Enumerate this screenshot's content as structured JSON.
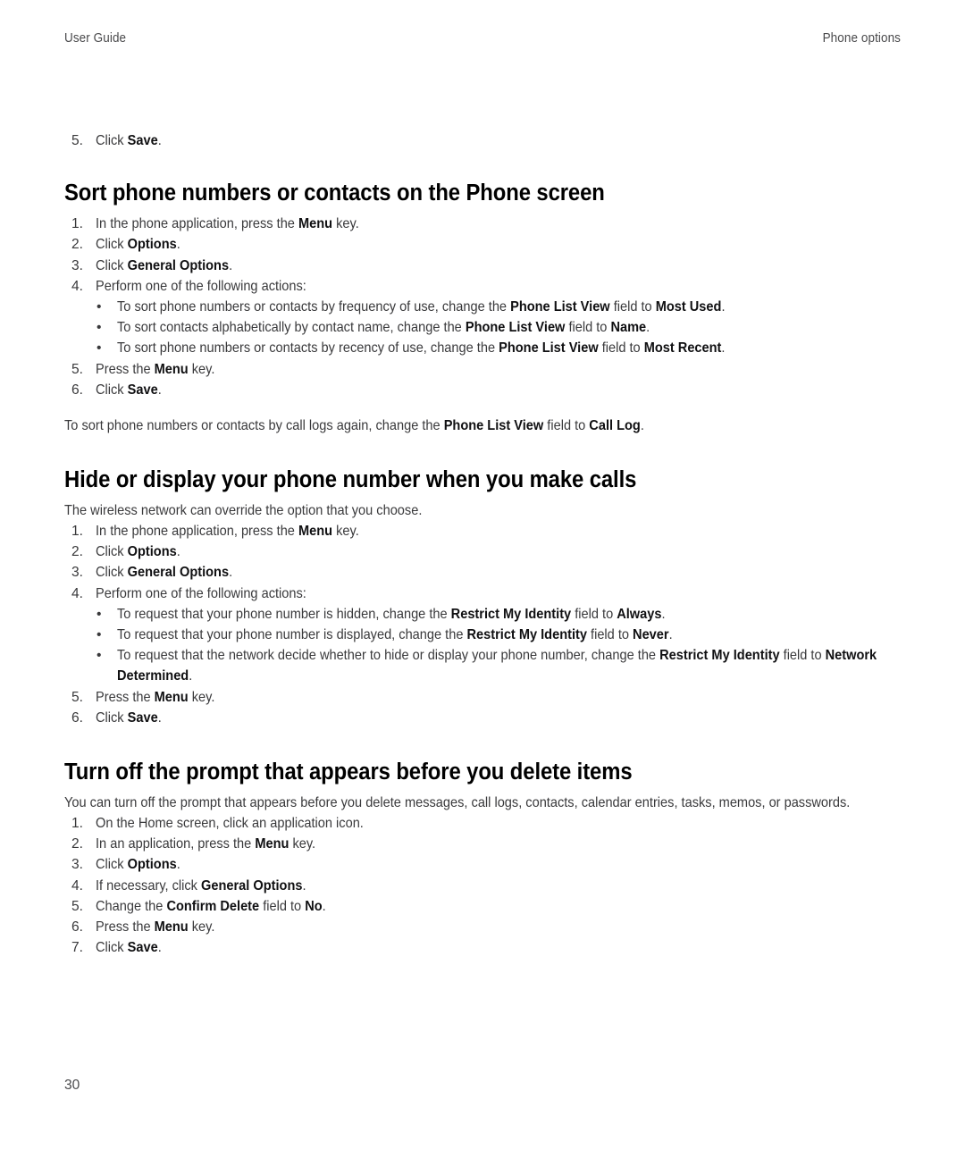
{
  "header": {
    "left": "User Guide",
    "right": "Phone options"
  },
  "folio": {
    "page_number": "30"
  },
  "intro_step": {
    "number": "5.",
    "text_before": "Click ",
    "bold": "Save",
    "text_after": "."
  },
  "sections": [
    {
      "id": "sort-phone-numbers",
      "title": "Sort phone numbers or contacts on the Phone screen",
      "intro": "",
      "steps": [
        {
          "number": "1.",
          "parts": [
            {
              "t": "In the phone application, press the ",
              "b": false
            },
            {
              "t": "Menu",
              "b": true
            },
            {
              "t": " key.",
              "b": false
            }
          ]
        },
        {
          "number": "2.",
          "parts": [
            {
              "t": "Click ",
              "b": false
            },
            {
              "t": "Options",
              "b": true
            },
            {
              "t": ".",
              "b": false
            }
          ]
        },
        {
          "number": "3.",
          "parts": [
            {
              "t": "Click ",
              "b": false
            },
            {
              "t": "General Options",
              "b": true
            },
            {
              "t": ".",
              "b": false
            }
          ]
        },
        {
          "number": "4.",
          "parts": [
            {
              "t": "Perform one of the following actions:",
              "b": false
            }
          ]
        }
      ],
      "bullets": [
        {
          "bullet": "•",
          "parts": [
            {
              "t": "To sort phone numbers or contacts by frequency of use, change the ",
              "b": false
            },
            {
              "t": "Phone List View",
              "b": true
            },
            {
              "t": " field to ",
              "b": false
            },
            {
              "t": "Most Used",
              "b": true
            },
            {
              "t": ".",
              "b": false
            }
          ]
        },
        {
          "bullet": "•",
          "parts": [
            {
              "t": "To sort contacts alphabetically by contact name, change the ",
              "b": false
            },
            {
              "t": "Phone List View",
              "b": true
            },
            {
              "t": " field to ",
              "b": false
            },
            {
              "t": "Name",
              "b": true
            },
            {
              "t": ".",
              "b": false
            }
          ]
        },
        {
          "bullet": "•",
          "parts": [
            {
              "t": "To sort phone numbers or contacts by recency of use, change the ",
              "b": false
            },
            {
              "t": "Phone List View",
              "b": true
            },
            {
              "t": " field to ",
              "b": false
            },
            {
              "t": "Most Recent",
              "b": true
            },
            {
              "t": ".",
              "b": false
            }
          ]
        }
      ],
      "steps_after": [
        {
          "number": "5.",
          "parts": [
            {
              "t": "Press the ",
              "b": false
            },
            {
              "t": "Menu",
              "b": true
            },
            {
              "t": " key.",
              "b": false
            }
          ]
        },
        {
          "number": "6.",
          "parts": [
            {
              "t": "Click ",
              "b": false
            },
            {
              "t": "Save",
              "b": true
            },
            {
              "t": ".",
              "b": false
            }
          ]
        }
      ],
      "outro": [
        {
          "t": "To sort phone numbers or contacts by call logs again, change the ",
          "b": false
        },
        {
          "t": "Phone List View",
          "b": true
        },
        {
          "t": " field to ",
          "b": false
        },
        {
          "t": "Call Log",
          "b": true
        },
        {
          "t": ".",
          "b": false
        }
      ]
    },
    {
      "id": "hide-or-display-number",
      "title": "Hide or display your phone number when you make calls",
      "intro": "The wireless network can override the option that you choose.",
      "steps": [
        {
          "number": "1.",
          "parts": [
            {
              "t": "In the phone application, press the ",
              "b": false
            },
            {
              "t": "Menu",
              "b": true
            },
            {
              "t": " key.",
              "b": false
            }
          ]
        },
        {
          "number": "2.",
          "parts": [
            {
              "t": "Click ",
              "b": false
            },
            {
              "t": "Options",
              "b": true
            },
            {
              "t": ".",
              "b": false
            }
          ]
        },
        {
          "number": "3.",
          "parts": [
            {
              "t": "Click ",
              "b": false
            },
            {
              "t": "General Options",
              "b": true
            },
            {
              "t": ".",
              "b": false
            }
          ]
        },
        {
          "number": "4.",
          "parts": [
            {
              "t": "Perform one of the following actions:",
              "b": false
            }
          ]
        }
      ],
      "bullets": [
        {
          "bullet": "•",
          "parts": [
            {
              "t": "To request that your phone number is hidden, change the ",
              "b": false
            },
            {
              "t": "Restrict My Identity",
              "b": true
            },
            {
              "t": " field to ",
              "b": false
            },
            {
              "t": "Always",
              "b": true
            },
            {
              "t": ".",
              "b": false
            }
          ]
        },
        {
          "bullet": "•",
          "parts": [
            {
              "t": "To request that your phone number is displayed, change the ",
              "b": false
            },
            {
              "t": "Restrict My Identity",
              "b": true
            },
            {
              "t": " field to ",
              "b": false
            },
            {
              "t": "Never",
              "b": true
            },
            {
              "t": ".",
              "b": false
            }
          ]
        },
        {
          "bullet": "•",
          "parts": [
            {
              "t": "To request that the network decide whether to hide or display your phone number, change the ",
              "b": false
            },
            {
              "t": "Restrict My Identity",
              "b": true
            },
            {
              "t": " field to ",
              "b": false
            },
            {
              "t": "Network Determined",
              "b": true
            },
            {
              "t": ".",
              "b": false
            }
          ]
        }
      ],
      "steps_after": [
        {
          "number": "5.",
          "parts": [
            {
              "t": "Press the ",
              "b": false
            },
            {
              "t": "Menu",
              "b": true
            },
            {
              "t": " key.",
              "b": false
            }
          ]
        },
        {
          "number": "6.",
          "parts": [
            {
              "t": "Click ",
              "b": false
            },
            {
              "t": "Save",
              "b": true
            },
            {
              "t": ".",
              "b": false
            }
          ]
        }
      ],
      "outro": []
    },
    {
      "id": "turn-off-delete-prompt",
      "title": "Turn off the prompt that appears before you delete items",
      "intro": "You can turn off the prompt that appears before you delete messages, call logs, contacts, calendar entries, tasks, memos, or passwords.",
      "steps": [
        {
          "number": "1.",
          "parts": [
            {
              "t": "On the Home screen, click an application icon.",
              "b": false
            }
          ]
        },
        {
          "number": "2.",
          "parts": [
            {
              "t": "In an application, press the ",
              "b": false
            },
            {
              "t": "Menu",
              "b": true
            },
            {
              "t": " key.",
              "b": false
            }
          ]
        },
        {
          "number": "3.",
          "parts": [
            {
              "t": "Click ",
              "b": false
            },
            {
              "t": "Options",
              "b": true
            },
            {
              "t": ".",
              "b": false
            }
          ]
        },
        {
          "number": "4.",
          "parts": [
            {
              "t": "If necessary, click ",
              "b": false
            },
            {
              "t": "General Options",
              "b": true
            },
            {
              "t": ".",
              "b": false
            }
          ]
        },
        {
          "number": "5.",
          "parts": [
            {
              "t": "Change the ",
              "b": false
            },
            {
              "t": "Confirm Delete",
              "b": true
            },
            {
              "t": " field to ",
              "b": false
            },
            {
              "t": "No",
              "b": true
            },
            {
              "t": ".",
              "b": false
            }
          ]
        },
        {
          "number": "6.",
          "parts": [
            {
              "t": "Press the ",
              "b": false
            },
            {
              "t": "Menu",
              "b": true
            },
            {
              "t": " key.",
              "b": false
            }
          ]
        },
        {
          "number": "7.",
          "parts": [
            {
              "t": "Click ",
              "b": false
            },
            {
              "t": "Save",
              "b": true
            },
            {
              "t": ".",
              "b": false
            }
          ]
        }
      ],
      "bullets": [],
      "steps_after": [],
      "outro": []
    }
  ]
}
